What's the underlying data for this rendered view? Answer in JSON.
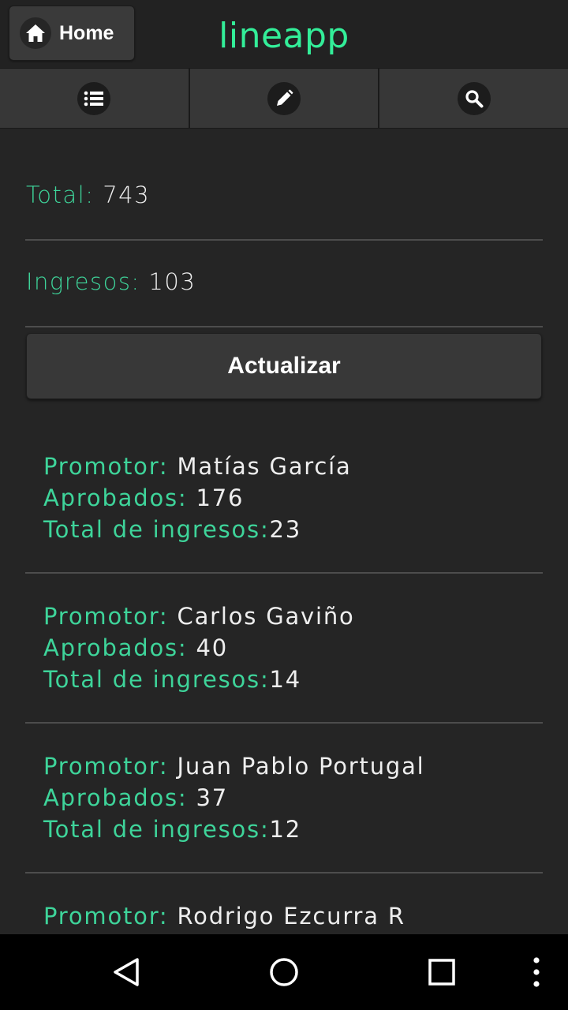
{
  "header": {
    "home_label": "Home",
    "app_title": "lineapp"
  },
  "tabs": [
    {
      "icon": "list-icon"
    },
    {
      "icon": "pencil-icon"
    },
    {
      "icon": "search-icon"
    }
  ],
  "summary": {
    "total_label": "Total:",
    "total_value": "743",
    "ingresos_label": "Ingresos:",
    "ingresos_value": "103"
  },
  "update_button_label": "Actualizar",
  "promotores": [
    {
      "promotor_label": "Promotor:",
      "name": "Matías García",
      "aprobados_label": "Aprobados:",
      "aprobados": "176",
      "ingresos_label": "Total de ingresos:",
      "ingresos": "23"
    },
    {
      "promotor_label": "Promotor:",
      "name": "Carlos Gaviño",
      "aprobados_label": "Aprobados:",
      "aprobados": "40",
      "ingresos_label": "Total de ingresos:",
      "ingresos": "14"
    },
    {
      "promotor_label": "Promotor:",
      "name": "Juan Pablo Portugal",
      "aprobados_label": "Aprobados:",
      "aprobados": "37",
      "ingresos_label": "Total de ingresos:",
      "ingresos": "12"
    },
    {
      "promotor_label": "Promotor:",
      "name": "Rodrigo Ezcurra R"
    }
  ],
  "colors": {
    "accent": "#33ee99",
    "label_green": "#3ed49a",
    "background": "#252525"
  },
  "system_nav": {
    "back_icon": "back-triangle-icon",
    "home_icon": "home-circle-icon",
    "recents_icon": "recents-square-icon",
    "menu_icon": "overflow-menu-icon"
  }
}
